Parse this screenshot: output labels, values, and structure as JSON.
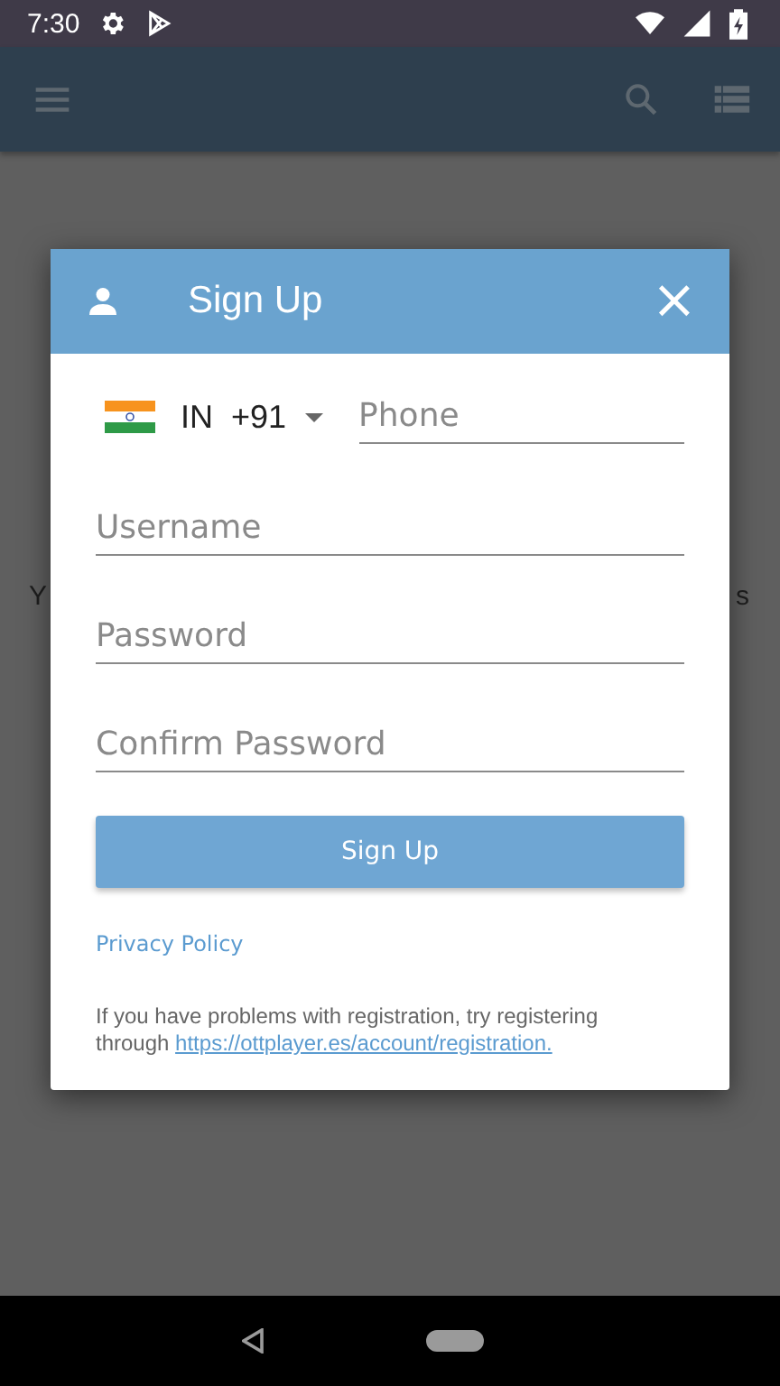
{
  "status_bar": {
    "time": "7:30"
  },
  "background": {
    "text_left": "Y",
    "text_right": "s"
  },
  "dialog": {
    "title": "Sign Up",
    "close": "×",
    "phone": {
      "country": "IN",
      "code": "+91",
      "placeholder": "Phone"
    },
    "fields": [
      {
        "placeholder": "Username"
      },
      {
        "placeholder": "Password"
      },
      {
        "placeholder": "Confirm Password"
      }
    ],
    "button": "Sign Up",
    "privacy_link": "Privacy Policy",
    "help_text": "If you have problems with registration, try registering through",
    "help_link": "https://ottplayer.es/account/registration."
  }
}
